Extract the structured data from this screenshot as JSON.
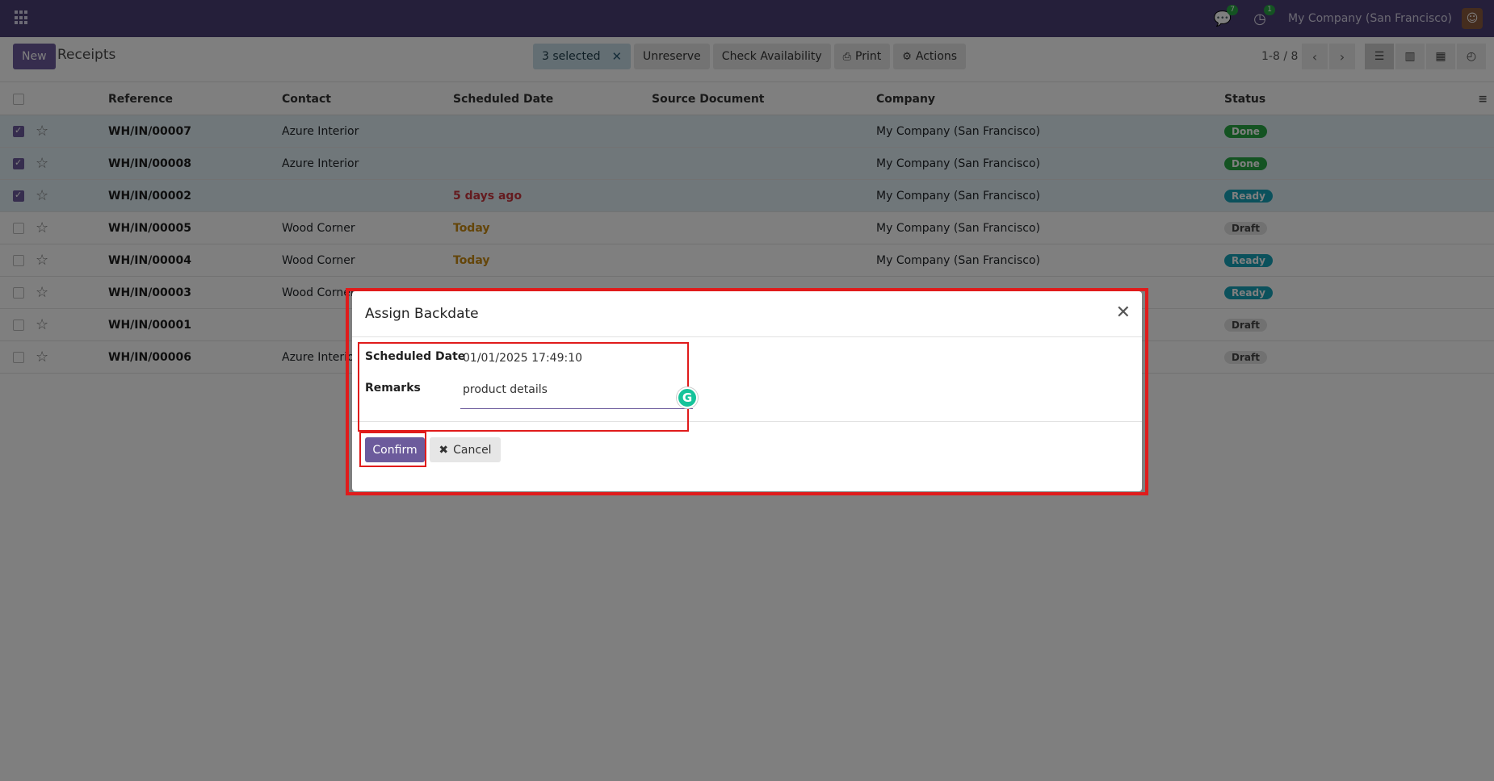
{
  "navbar": {
    "company": "My Company (San Francisco)",
    "chat_badge": "7",
    "activity_badge": "1",
    "icons": [
      "apps-icon",
      "chat-icon",
      "clock-icon",
      "avatar"
    ]
  },
  "control": {
    "new_label": "New",
    "breadcrumb": "Receipts",
    "selected_label": "3 selected",
    "unreserve_label": "Unreserve",
    "check_availability_label": "Check Availability",
    "print_label": "Print",
    "actions_label": "Actions",
    "pager": "1-8 / 8"
  },
  "table": {
    "columns": [
      "Reference",
      "Contact",
      "Scheduled Date",
      "Source Document",
      "Company",
      "Status"
    ],
    "rows": [
      {
        "ref": "WH/IN/00007",
        "contact": "Azure Interior",
        "date": "",
        "date_style": "",
        "company": "My Company (San Francisco)",
        "status": "Done",
        "status_style": "done",
        "selected": true
      },
      {
        "ref": "WH/IN/00008",
        "contact": "Azure Interior",
        "date": "",
        "date_style": "",
        "company": "My Company (San Francisco)",
        "status": "Done",
        "status_style": "done",
        "selected": true
      },
      {
        "ref": "WH/IN/00002",
        "contact": "",
        "date": "5 days ago",
        "date_style": "late",
        "company": "My Company (San Francisco)",
        "status": "Ready",
        "status_style": "ready",
        "selected": true
      },
      {
        "ref": "WH/IN/00005",
        "contact": "Wood Corner",
        "date": "Today",
        "date_style": "today",
        "company": "My Company (San Francisco)",
        "status": "Draft",
        "status_style": "draft",
        "selected": false
      },
      {
        "ref": "WH/IN/00004",
        "contact": "Wood Corner",
        "date": "Today",
        "date_style": "today",
        "company": "My Company (San Francisco)",
        "status": "Ready",
        "status_style": "ready",
        "selected": false
      },
      {
        "ref": "WH/IN/00003",
        "contact": "Wood Corner",
        "date": "",
        "date_style": "",
        "company": "",
        "status": "Ready",
        "status_style": "ready",
        "selected": false
      },
      {
        "ref": "WH/IN/00001",
        "contact": "",
        "date": "",
        "date_style": "",
        "company": "",
        "status": "Draft",
        "status_style": "draft",
        "selected": false
      },
      {
        "ref": "WH/IN/00006",
        "contact": "Azure Interior",
        "date": "",
        "date_style": "",
        "company": "",
        "status": "Draft",
        "status_style": "draft",
        "selected": false
      }
    ]
  },
  "dialog": {
    "title": "Assign Backdate",
    "scheduled_date_label": "Scheduled Date",
    "scheduled_date_value": "01/01/2025 17:49:10",
    "remarks_label": "Remarks",
    "remarks_value": "product details",
    "confirm_label": "Confirm",
    "cancel_label": "Cancel"
  },
  "colors": {
    "navbar": "#4a3f74",
    "primary": "#6c5b9c",
    "highlight": "#e01b1b"
  }
}
